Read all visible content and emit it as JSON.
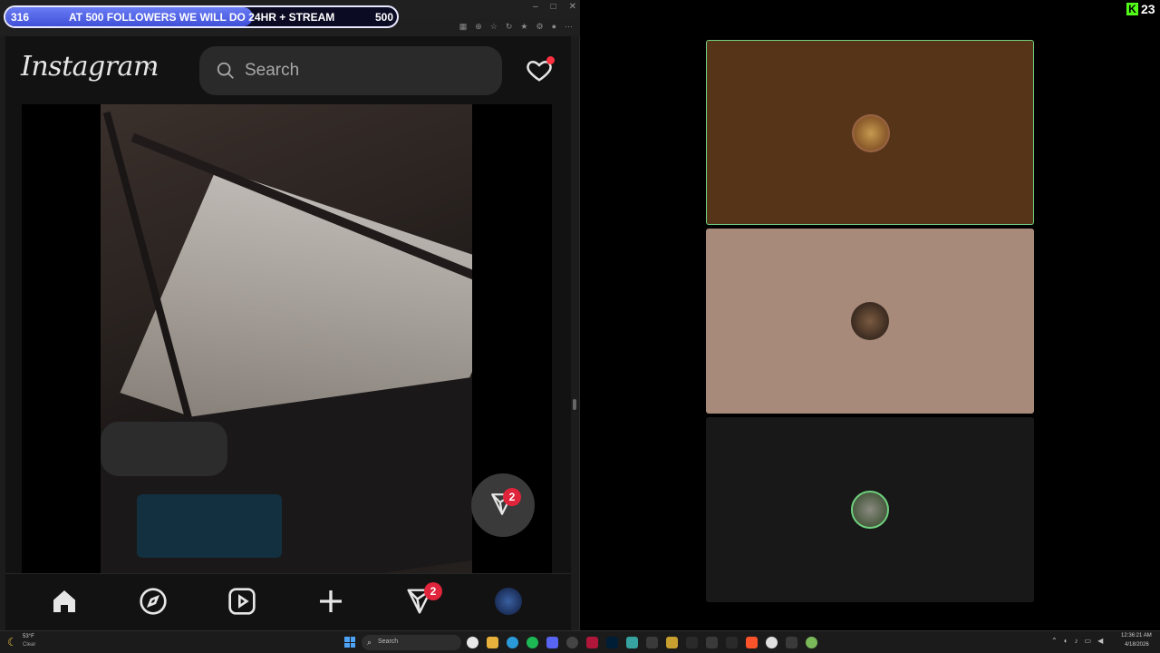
{
  "stream_banner": {
    "current_count": "316",
    "goal_text": "AT 500 FOLLOWERS WE WILL DO 24HR + STREAM",
    "goal_count": "500",
    "progress_fraction": 0.632
  },
  "browser": {
    "window_controls": [
      "–",
      "□",
      "✕"
    ]
  },
  "instagram": {
    "logo_text": "Instagram",
    "search_placeholder": "Search",
    "notifications_dot": true,
    "fab_badge": "2",
    "nav": {
      "items": [
        "home-icon",
        "explore-icon",
        "reels-icon",
        "create-icon",
        "direct-message-icon",
        "profile-avatar"
      ],
      "messages_badge": "2"
    }
  },
  "kick": {
    "logo_letter": "K",
    "viewer_count": "23",
    "brand_color": "#53fc18"
  },
  "call_tiles": [
    {
      "bg_color": "#553418",
      "active_speaker": true
    },
    {
      "bg_color": "#a88a7a",
      "active_speaker": false
    },
    {
      "bg_color": "#181818",
      "active_speaker": false
    }
  ],
  "taskbar": {
    "weather_temp": "53°F",
    "weather_condition": "Clear",
    "search_label": "Search",
    "clock_time": "12:36:21 AM",
    "clock_date": "4/18/2026"
  }
}
